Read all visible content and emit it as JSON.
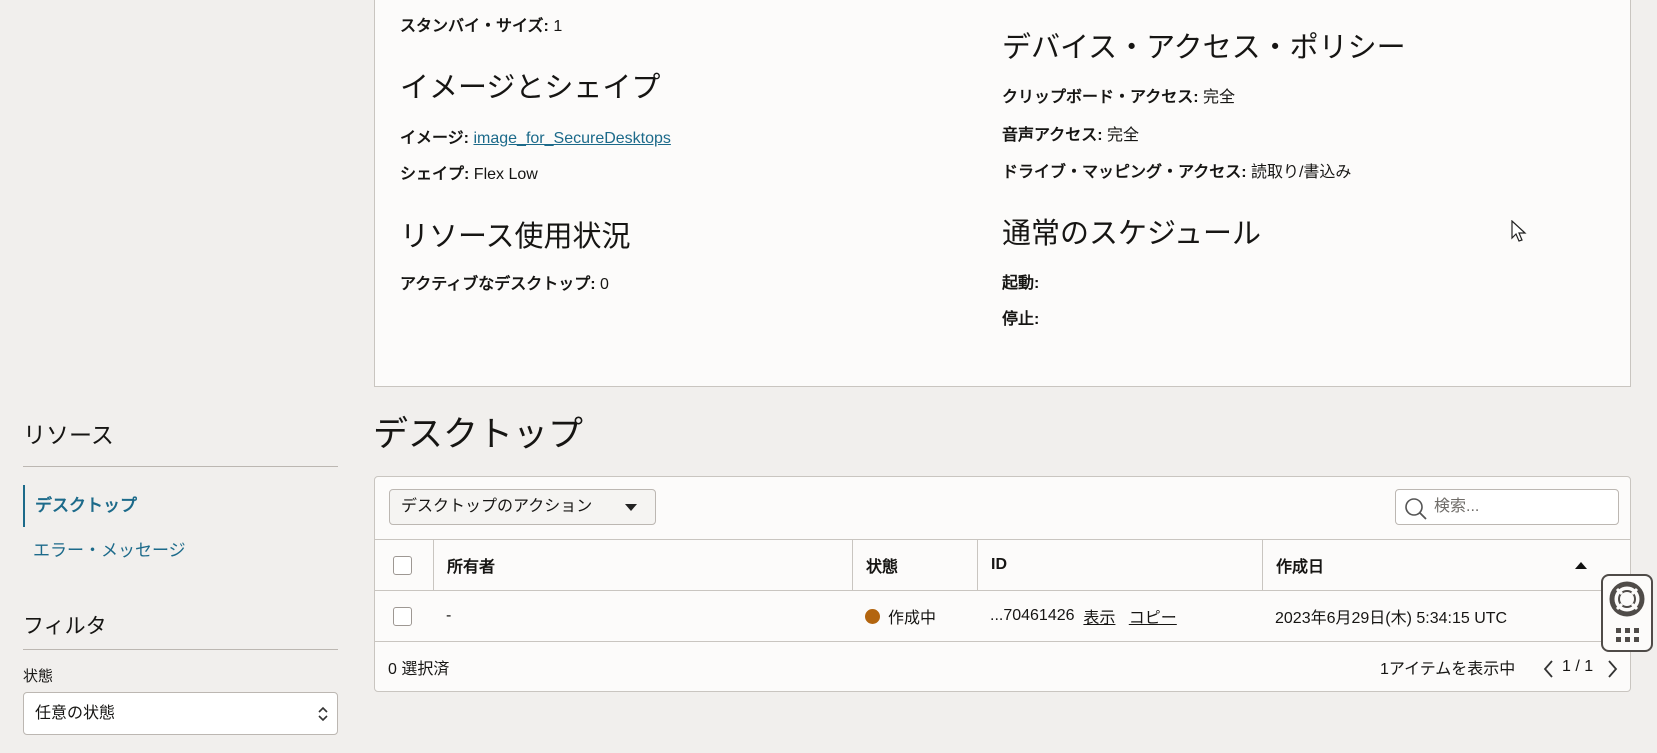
{
  "details": {
    "standby_label": "スタンバイ・サイズ:",
    "standby_value": "1",
    "image_shape_heading": "イメージとシェイプ",
    "image_label": "イメージ:",
    "image_value": "image_for_SecureDesktops",
    "shape_label": "シェイプ:",
    "shape_value": "Flex Low",
    "usage_heading": "リソース使用状況",
    "active_label": "アクティブなデスクトップ:",
    "active_value": "0",
    "policy_heading": "デバイス・アクセス・ポリシー",
    "clipboard_label": "クリップボード・アクセス:",
    "clipboard_value": "完全",
    "audio_label": "音声アクセス:",
    "audio_value": "完全",
    "drive_label": "ドライブ・マッピング・アクセス:",
    "drive_value": "読取り/書込み",
    "schedule_heading": "通常のスケジュール",
    "start_label": "起動:",
    "stop_label": "停止:"
  },
  "sidebar": {
    "resources_heading": "リソース",
    "items": [
      {
        "label": "デスクトップ"
      },
      {
        "label": "エラー・メッセージ"
      }
    ],
    "filter_heading": "フィルタ",
    "state_label": "状態",
    "state_value": "任意の状態"
  },
  "desktops": {
    "heading": "デスクトップ",
    "actions_label": "デスクトップのアクション",
    "search_placeholder": "検索...",
    "columns": [
      "所有者",
      "状態",
      "ID",
      "作成日"
    ],
    "rows": [
      {
        "owner": "-",
        "state": "作成中",
        "state_color": "#b3650f",
        "id": "...70461426",
        "view": "表示",
        "copy": "コピー",
        "created": "2023年6月29日(木) 5:34:15 UTC"
      }
    ],
    "selected": "0 選択済",
    "showing": "1アイテムを表示中",
    "page": "1 / 1"
  }
}
